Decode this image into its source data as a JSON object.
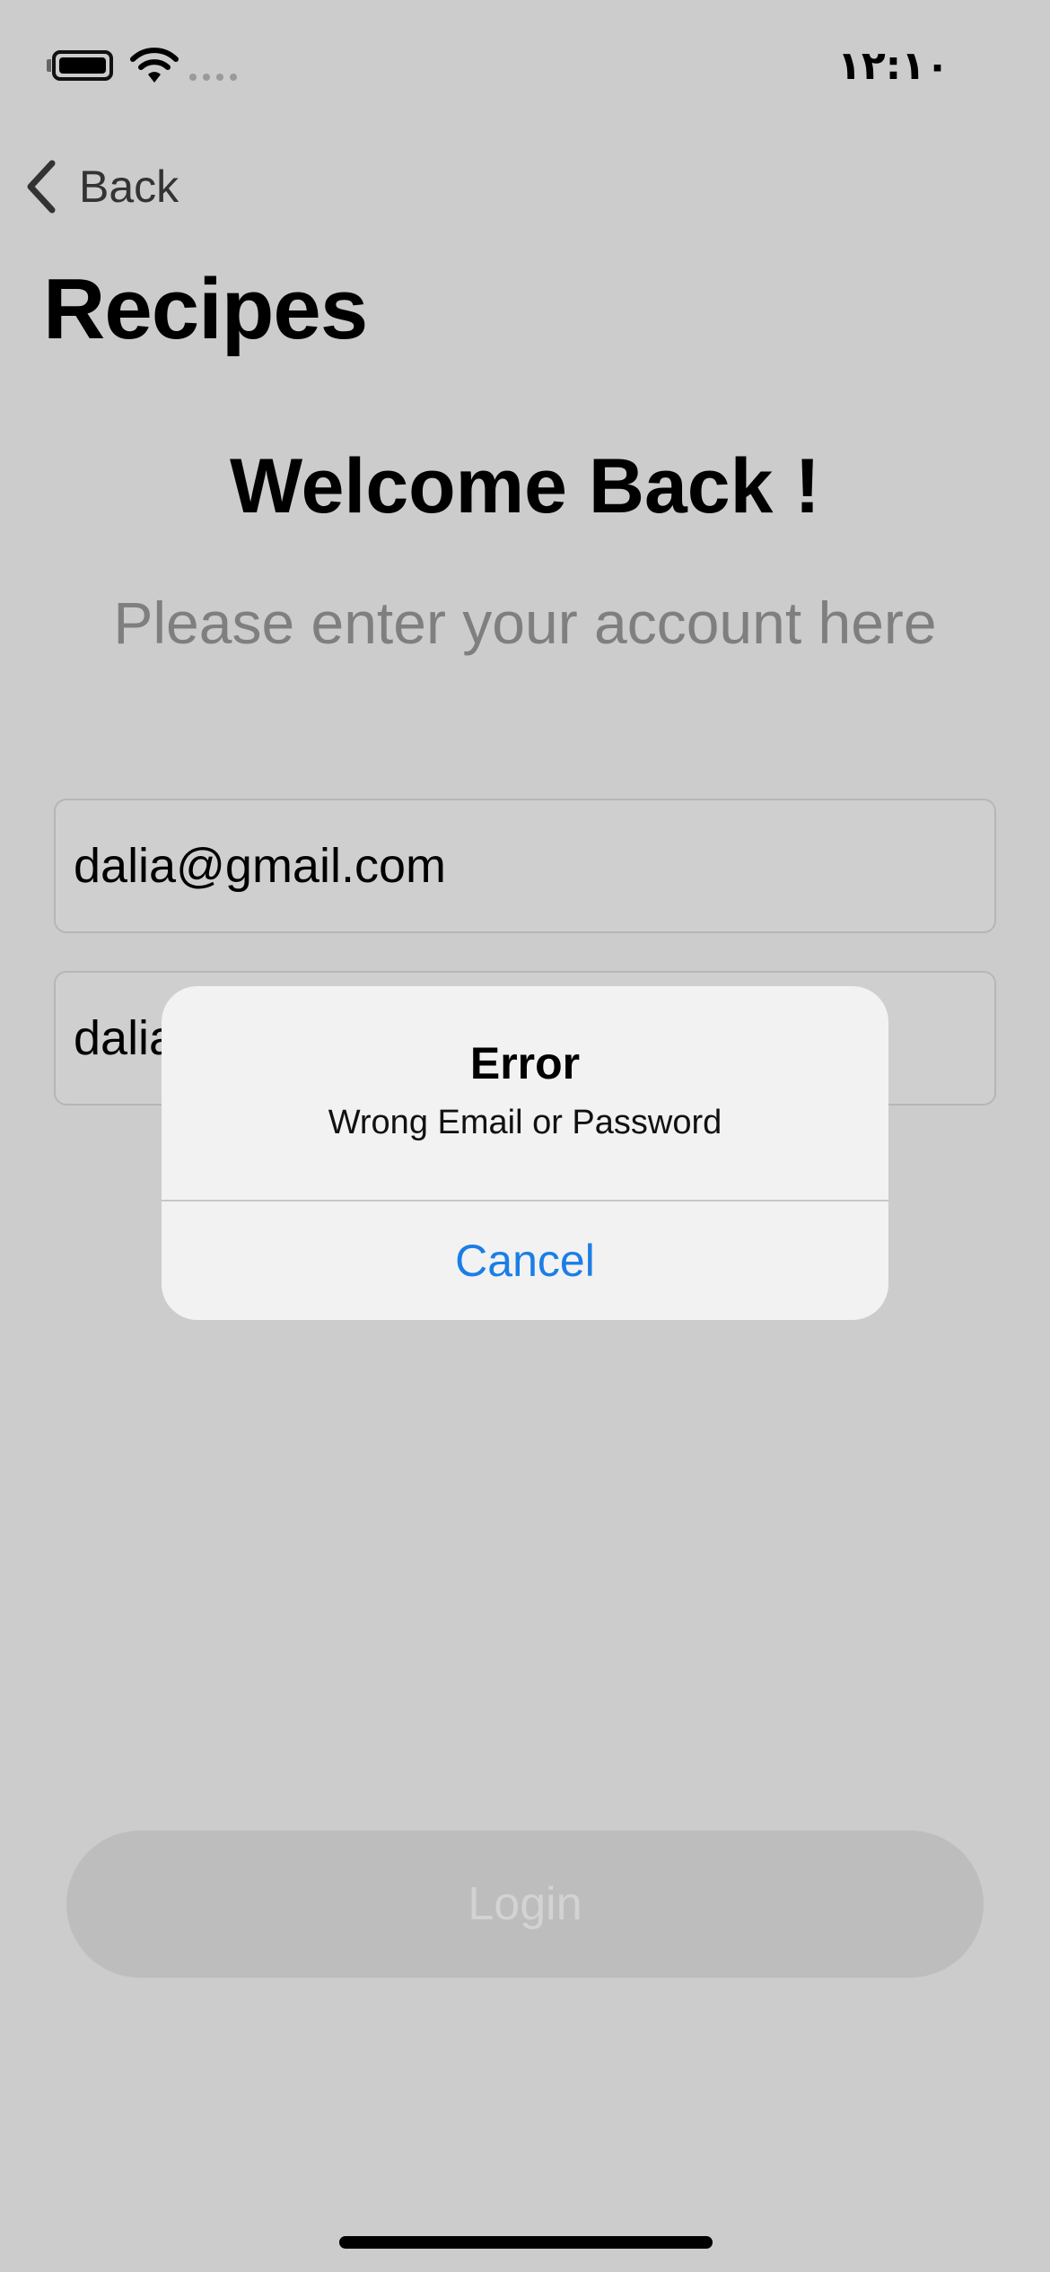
{
  "status_bar": {
    "time": "١٢:١٠",
    "battery_icon": "battery-full-icon",
    "wifi_icon": "wifi-icon",
    "signal_icon": "cellular-signal-icon"
  },
  "nav": {
    "back_label": "Back",
    "back_icon": "chevron-left-icon",
    "title": "Recipes"
  },
  "login_form": {
    "heading": "Welcome Back !",
    "subheading": "Please enter your account here",
    "email_value": "dalia@gmail.com",
    "password_value": "dalia",
    "login_label": "Login"
  },
  "alert": {
    "title": "Error",
    "message": "Wrong Email or Password",
    "cancel_label": "Cancel"
  },
  "colors": {
    "background": "#cccccc",
    "alert_background": "#f2f2f2",
    "accent": "#1a7ee6",
    "subtitle": "#7f7f7f",
    "login_button_disabled": "#bdbdbd"
  }
}
